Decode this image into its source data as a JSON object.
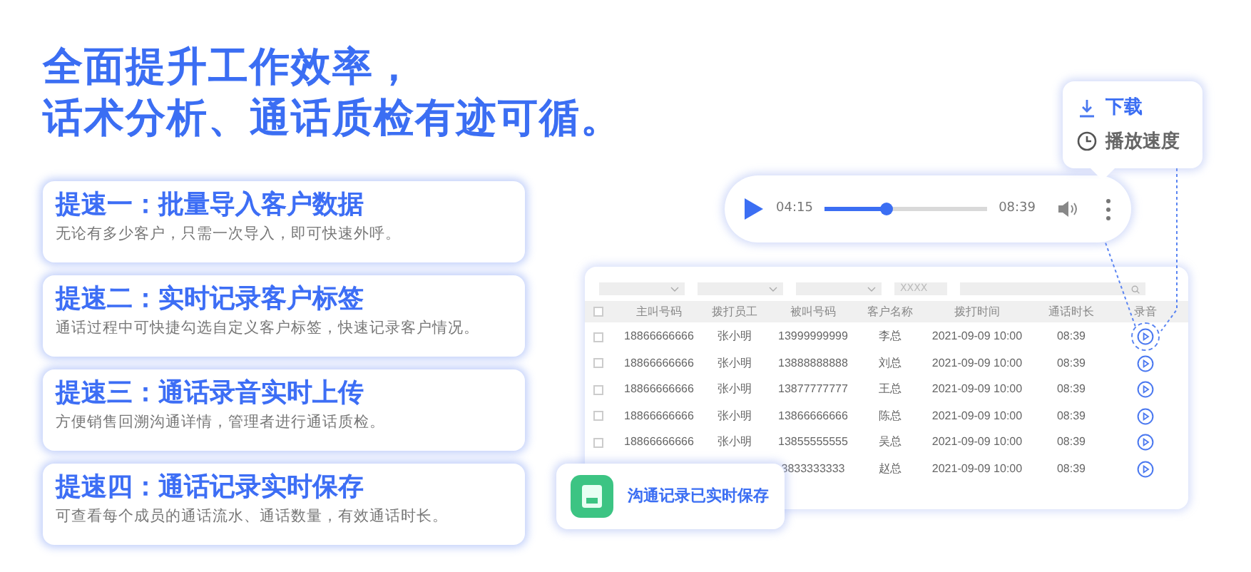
{
  "headline": [
    "全面提升工作效率，",
    "话术分析、通话质检有迹可循。"
  ],
  "features": [
    {
      "title": "提速一：批量导入客户数据",
      "description": "无论有多少客户，只需一次导入，即可快速外呼。"
    },
    {
      "title": "提速二：实时记录客户标签",
      "description": "通话过程中可快捷勾选自定义客户标签，快速记录客户情况。"
    },
    {
      "title": "提速三：通话录音实时上传",
      "description": "方便销售回溯沟通详情，管理者进行通话质检。"
    },
    {
      "title": "提速四：通话记录实时保存",
      "description": "可查看每个成员的通话流水、通话数量，有效通话时长。"
    }
  ],
  "menu": [
    {
      "kind": "download",
      "label": "下载",
      "selected": true
    },
    {
      "kind": "speed",
      "label": "播放速度",
      "selected": false
    }
  ],
  "player": {
    "elapsed": "04:15",
    "total": "08:39",
    "level": 0.38
  },
  "table": {
    "filters": [
      {
        "kind": "select"
      },
      {
        "kind": "select"
      },
      {
        "kind": "select"
      },
      {
        "kind": "text",
        "placeholder": "XXXX"
      },
      {
        "kind": "search"
      }
    ],
    "all_checked": false,
    "columns": [
      "主叫号码",
      "拨打员工",
      "被叫号码",
      "客户名称",
      "拨打时间",
      "通话时长",
      "录音"
    ],
    "rows": [
      {
        "cells": [
          "18866666666",
          "张小明",
          "13999999999",
          "李总",
          "2021-09-09 10:00",
          "08:39"
        ],
        "highlighted": true,
        "checked": false
      },
      {
        "cells": [
          "18866666666",
          "张小明",
          "13888888888",
          "刘总",
          "2021-09-09 10:00",
          "08:39"
        ],
        "highlighted": false,
        "checked": false
      },
      {
        "cells": [
          "18866666666",
          "张小明",
          "13877777777",
          "王总",
          "2021-09-09 10:00",
          "08:39"
        ],
        "highlighted": false,
        "checked": false
      },
      {
        "cells": [
          "18866666666",
          "张小明",
          "13866666666",
          "陈总",
          "2021-09-09 10:00",
          "08:39"
        ],
        "highlighted": false,
        "checked": false
      },
      {
        "cells": [
          "18866666666",
          "张小明",
          "13855555555",
          "吴总",
          "2021-09-09 10:00",
          "08:39"
        ],
        "highlighted": false,
        "checked": false
      },
      {
        "cells": [
          null,
          null,
          "3833333333",
          "赵总",
          "2021-09-09 10:00",
          "08:39"
        ],
        "highlighted": false
      }
    ]
  },
  "badge": {
    "text": "沟通记录已实时保存"
  }
}
